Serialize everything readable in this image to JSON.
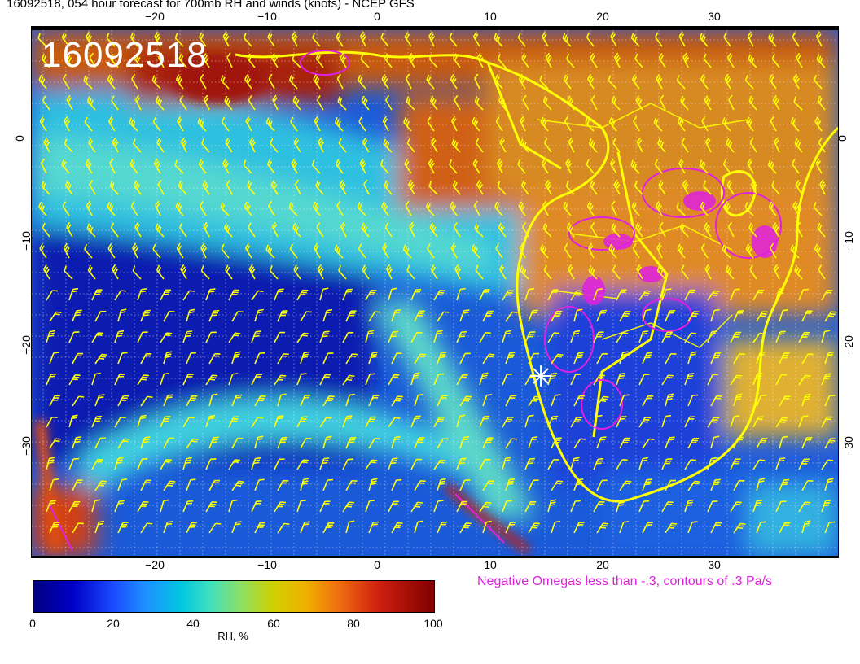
{
  "title": "16092518, 054 hour forecast for 700mb RH and winds (knots) - NCEP GFS",
  "stamp": "16092518",
  "lon_ticks": [
    "−20",
    "−10",
    "0",
    "10",
    "20",
    "30"
  ],
  "lat_ticks": [
    "0",
    "−10",
    "−20",
    "−30"
  ],
  "omega_note": "Negative Omegas less than -.3, contours of .3 Pa/s",
  "colorbar": {
    "labels": [
      "0",
      "20",
      "40",
      "60",
      "80",
      "100"
    ],
    "title": "RH, %"
  },
  "colors": {
    "barbs": "#ffff00",
    "omega": "#e020e0",
    "coast": "#ffff00"
  }
}
